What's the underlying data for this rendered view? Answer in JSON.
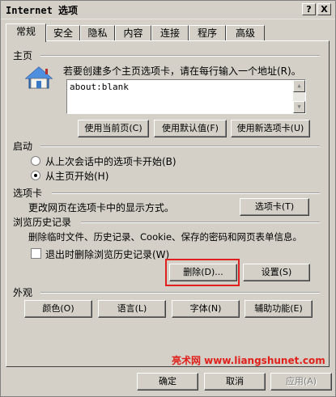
{
  "window": {
    "title": "Internet 选项",
    "help_glyph": "?",
    "close_glyph": "X"
  },
  "tabs": [
    {
      "label": "常规",
      "active": true
    },
    {
      "label": "安全"
    },
    {
      "label": "隐私"
    },
    {
      "label": "内容"
    },
    {
      "label": "连接"
    },
    {
      "label": "程序"
    },
    {
      "label": "高级"
    }
  ],
  "homepage": {
    "heading": "主页",
    "description": "若要创建多个主页选项卡，请在每行输入一个地址(R)。",
    "value": "about:blank",
    "buttons": [
      "使用当前页(C)",
      "使用默认值(F)",
      "使用新选项卡(U)"
    ]
  },
  "startup": {
    "heading": "启动",
    "options": [
      {
        "label": "从上次会话中的选项卡开始(B)",
        "selected": false
      },
      {
        "label": "从主页开始(H)",
        "selected": true
      }
    ]
  },
  "tabs_section": {
    "heading": "选项卡",
    "description": "更改网页在选项卡中的显示方式。",
    "button": "选项卡(T)"
  },
  "history": {
    "heading": "浏览历史记录",
    "description": "删除临时文件、历史记录、Cookie、保存的密码和网页表单信息。",
    "checkbox_label": "退出时删除浏览历史记录(W)",
    "checkbox_checked": false,
    "delete_button": "删除(D)...",
    "settings_button": "设置(S)"
  },
  "appearance": {
    "heading": "外观",
    "buttons": [
      "颜色(O)",
      "语言(L)",
      "字体(N)",
      "辅助功能(E)"
    ]
  },
  "footer": {
    "watermark": "亮术网 www.liangshunet.com",
    "ok": "确定",
    "cancel": "取消",
    "apply": "应用(A)"
  },
  "colors": {
    "face": "#d4d0c8",
    "highlight_box": "#e02020",
    "watermark": "#e0201a"
  },
  "icons": {
    "homepage": "house-icon"
  }
}
